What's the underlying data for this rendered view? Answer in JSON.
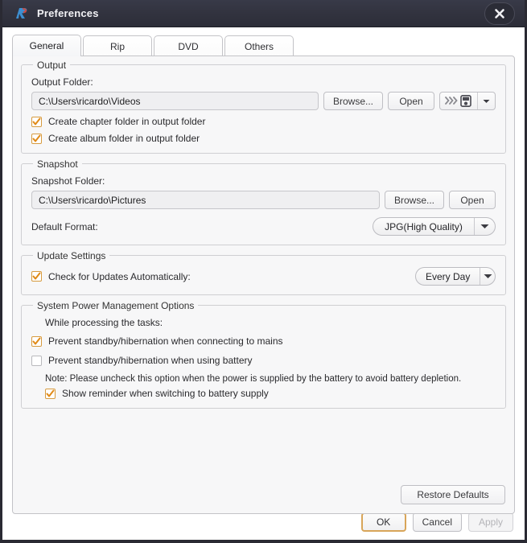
{
  "window": {
    "title": "Preferences",
    "logo_icon": "app-logo-r-icon",
    "close_icon": "close-icon",
    "accent_checkbox": "#d79b3f",
    "focus_border": "#d8a559",
    "titlebar_bg": "#32333f"
  },
  "tabs": [
    {
      "label": "General",
      "active": true
    },
    {
      "label": "Rip",
      "active": false
    },
    {
      "label": "DVD",
      "active": false
    },
    {
      "label": "Others",
      "active": false
    }
  ],
  "output": {
    "legend": "Output",
    "folder_label": "Output Folder:",
    "folder_value": "C:\\Users\\ricardo\\Videos",
    "folder_placeholder": "Output folder path",
    "browse_label": "Browse...",
    "open_label": "Open",
    "device_icon": "transfer-to-device-icon",
    "device_arrow_icon": "chevron-down-icon",
    "checkboxes": [
      {
        "label": "Create chapter folder in output folder",
        "checked": true
      },
      {
        "label": "Create album folder in output folder",
        "checked": true
      }
    ]
  },
  "snapshot": {
    "legend": "Snapshot",
    "folder_label": "Snapshot Folder:",
    "folder_value": "C:\\Users\\ricardo\\Pictures",
    "folder_placeholder": "Snapshot folder path",
    "browse_label": "Browse...",
    "open_label": "Open",
    "format_label": "Default Format:",
    "format_value": "JPG(High Quality)",
    "format_arrow_icon": "chevron-down-icon"
  },
  "update": {
    "legend": "Update Settings",
    "checkbox_label": "Check for Updates Automatically:",
    "checkbox_checked": true,
    "frequency_value": "Every Day",
    "frequency_arrow_icon": "chevron-down-icon"
  },
  "power": {
    "legend": "System Power Management Options",
    "intro": "While processing the tasks:",
    "option_mains": {
      "label": "Prevent standby/hibernation when connecting to mains",
      "checked": true
    },
    "option_battery": {
      "label": "Prevent standby/hibernation when using battery",
      "checked": false
    },
    "note": "Note: Please uncheck this option when the power is supplied by the battery to avoid battery depletion.",
    "option_reminder": {
      "label": "Show reminder when switching to battery supply",
      "checked": true
    }
  },
  "actions": {
    "restore_defaults": "Restore Defaults",
    "ok": "OK",
    "cancel": "Cancel",
    "apply": "Apply",
    "apply_disabled": true
  }
}
